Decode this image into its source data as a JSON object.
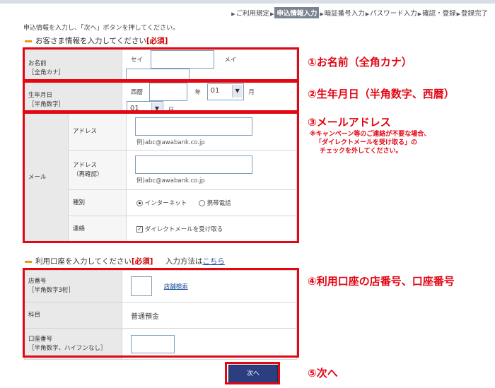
{
  "steps": [
    "ご利用規定",
    "申込情報入力",
    "暗証番号入力",
    "パスワード入力",
    "確認・登録",
    "登録完了"
  ],
  "intro": "申込情報を入力し、「次へ」ボタンを押してください。",
  "section1": {
    "title": "お客さま情報を入力してください",
    "required": "[必須]"
  },
  "name": {
    "label1": "お名前",
    "label2": "［全角カナ］",
    "sei": "セイ",
    "mei": "メイ",
    "sei_value": "",
    "mei_value": ""
  },
  "birth": {
    "label1": "生年月日",
    "label2": "［半角数字］",
    "era": "西暦",
    "year_unit": "年",
    "month": "01",
    "month_unit": "月",
    "day": "01",
    "day_unit": "日",
    "year_value": ""
  },
  "mail": {
    "label": "メール",
    "address_label": "アドレス",
    "address_example": "例)abc@awabank.co.jp",
    "confirm_label1": "アドレス",
    "confirm_label2": "（再確認）",
    "confirm_example": "例)abc@awabank.co.jp",
    "type_label": "種別",
    "type_internet": "インターネット",
    "type_mobile": "携帯電話",
    "contact_label": "連絡",
    "contact_checkbox": "ダイレクトメールを受け取る"
  },
  "section2": {
    "title": "利用口座を入力してください",
    "required": "[必須]",
    "method": "入力方法は",
    "method_link": "こちら"
  },
  "account": {
    "branch_label1": "店番号",
    "branch_label2": "［半角数字3桁］",
    "branch_search": "店舗検索",
    "subject_label": "科目",
    "subject_value": "普通預金",
    "number_label1": "口座番号",
    "number_label2": "［半角数字、ハイフンなし］"
  },
  "next_button": "次へ",
  "annotations": {
    "a1": "①お名前（全角カナ）",
    "a2": "②生年月日（半角数字、西暦）",
    "a3": "③メールアドレス",
    "a3_note1": "※キャンペーン等のご連絡が不要な場合、",
    "a3_note2": "「ダイレクトメールを受け取る」の",
    "a3_note3": "チェックを外してください。",
    "a4": "④利用口座の店番号、口座番号",
    "a5": "⑤次へ"
  },
  "colors": {
    "highlight": "#e30613",
    "required": "#cc0000",
    "button": "#2b3f80",
    "accent": "#e89a1a"
  }
}
